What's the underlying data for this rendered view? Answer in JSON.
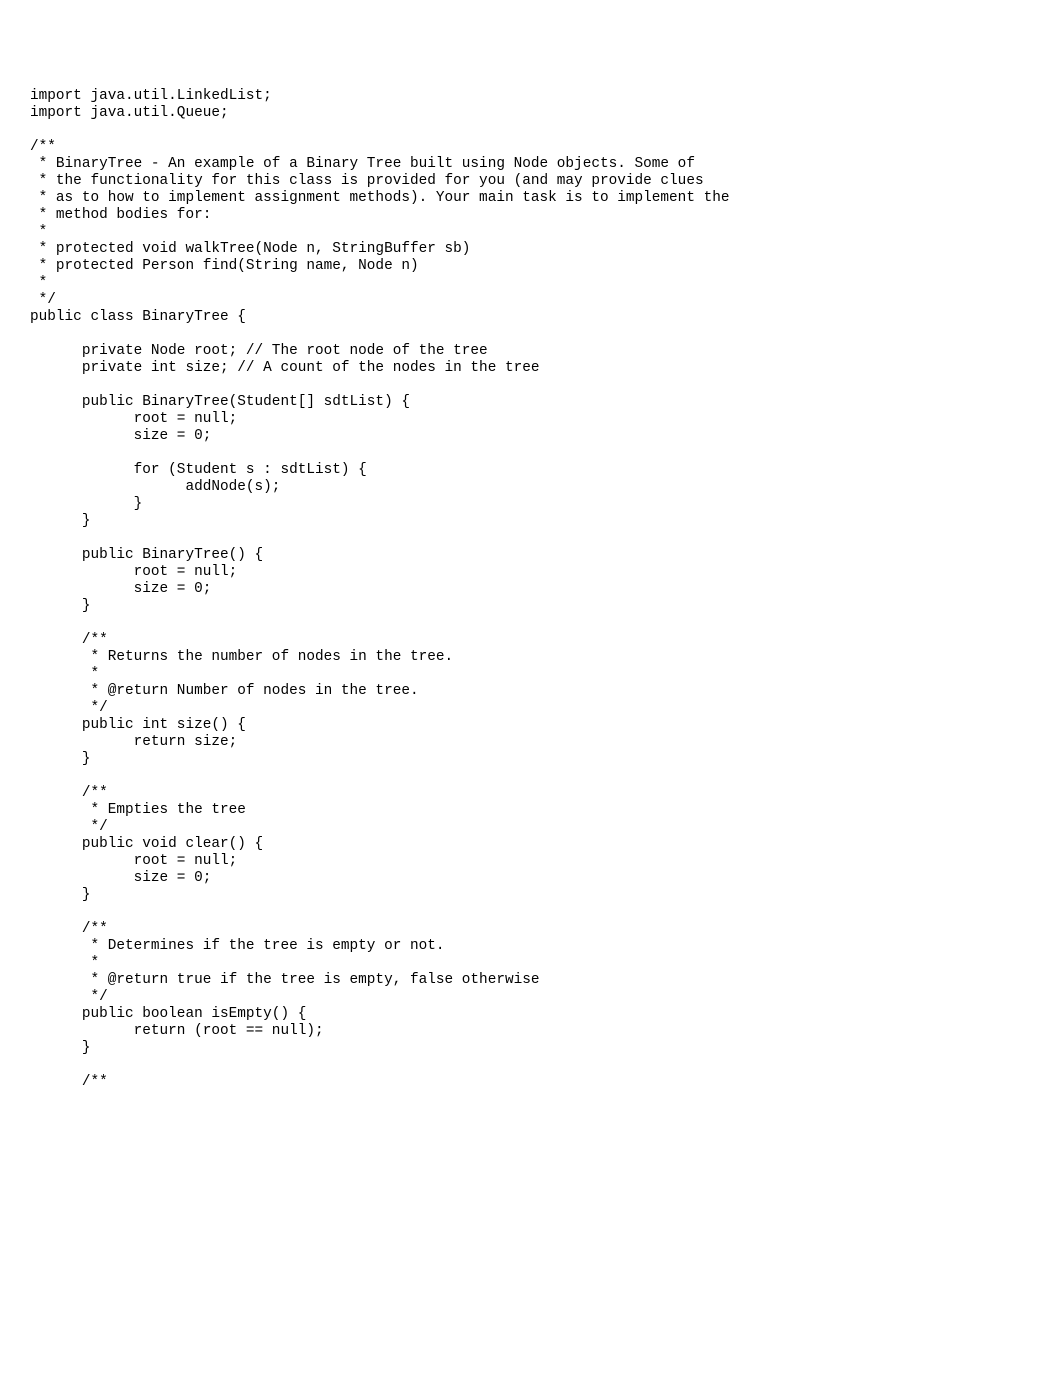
{
  "code": "import java.util.LinkedList;\nimport java.util.Queue;\n\n/**\n * BinaryTree - An example of a Binary Tree built using Node objects. Some of\n * the functionality for this class is provided for you (and may provide clues\n * as to how to implement assignment methods). Your main task is to implement the\n * method bodies for:\n *\n * protected void walkTree(Node n, StringBuffer sb)\n * protected Person find(String name, Node n)\n *\n */\npublic class BinaryTree {\n\n      private Node root; // The root node of the tree\n      private int size; // A count of the nodes in the tree\n\n      public BinaryTree(Student[] sdtList) {\n            root = null;\n            size = 0;\n\n            for (Student s : sdtList) {\n                  addNode(s);\n            }\n      }\n\n      public BinaryTree() {\n            root = null;\n            size = 0;\n      }\n\n      /**\n       * Returns the number of nodes in the tree.\n       *\n       * @return Number of nodes in the tree.\n       */\n      public int size() {\n            return size;\n      }\n\n      /**\n       * Empties the tree\n       */\n      public void clear() {\n            root = null;\n            size = 0;\n      }\n\n      /**\n       * Determines if the tree is empty or not.\n       *\n       * @return true if the tree is empty, false otherwise\n       */\n      public boolean isEmpty() {\n            return (root == null);\n      }\n\n      /**"
}
